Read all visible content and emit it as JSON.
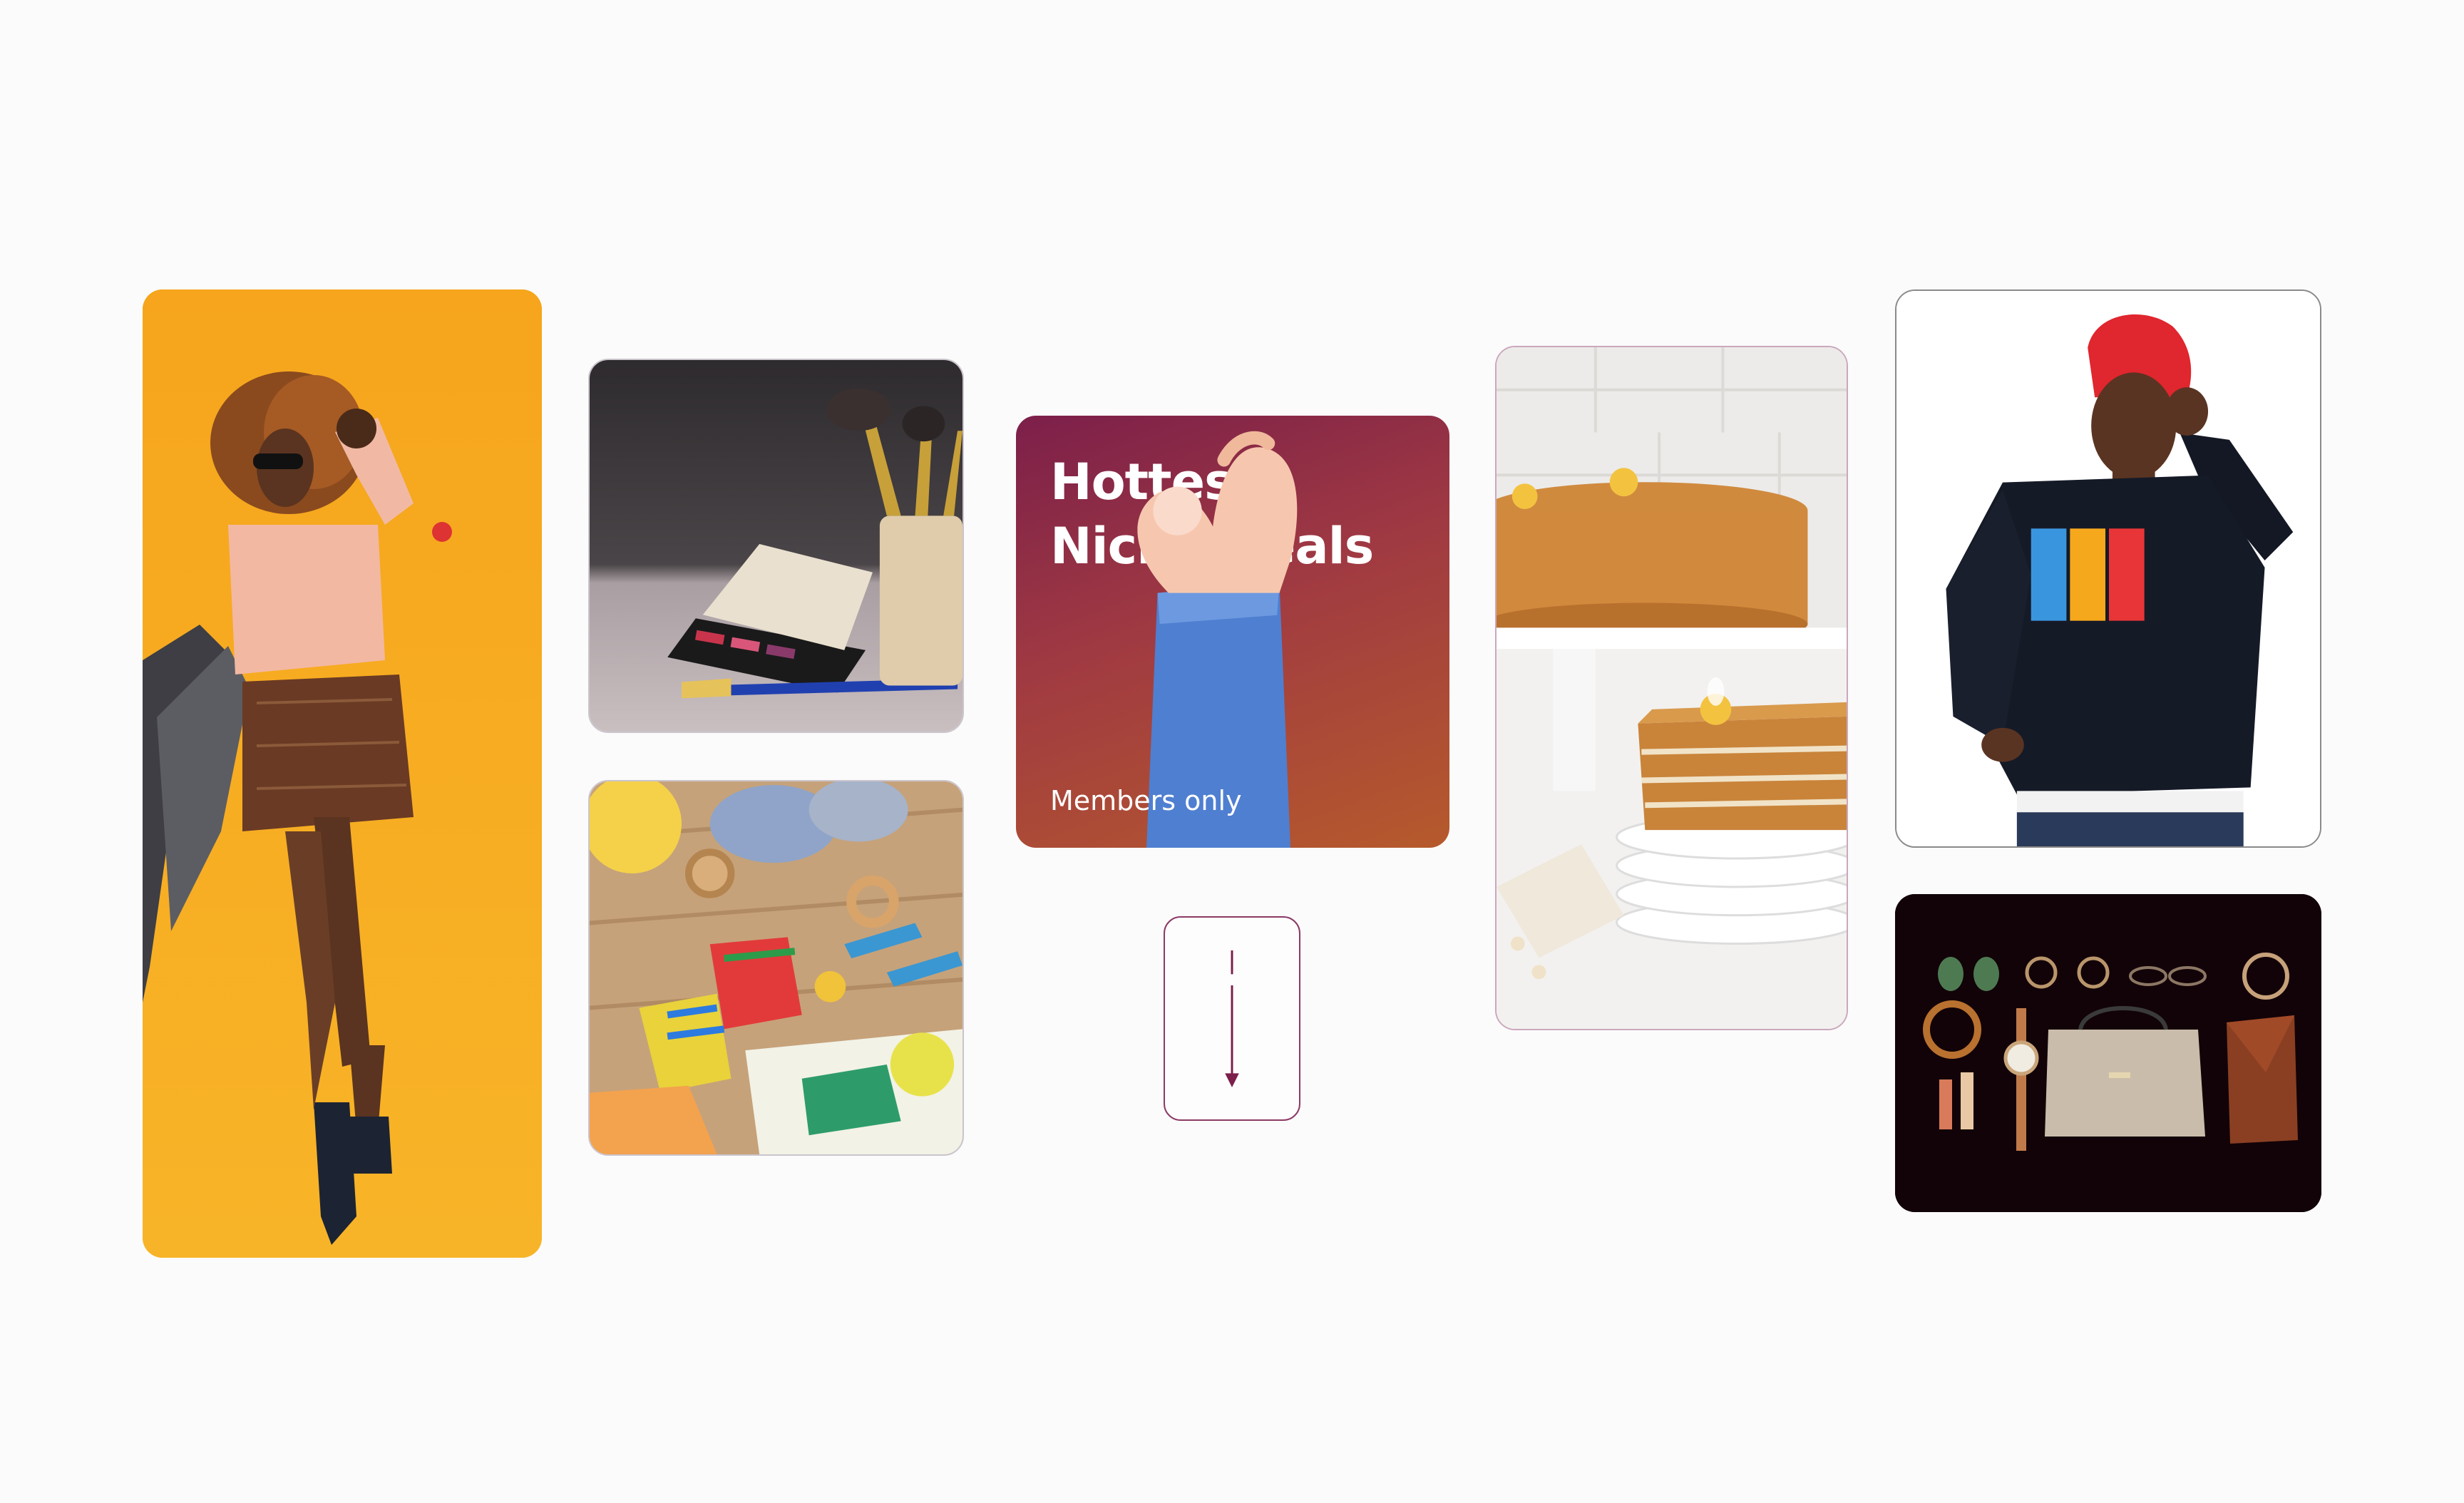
{
  "promo": {
    "title_line1": "Hottest",
    "title_line2": "Niche Deals",
    "subtitle": "Members only"
  },
  "tiles": [
    {
      "id": "fashion",
      "icon": "fashion-photo"
    },
    {
      "id": "makeup",
      "icon": "makeup-brushes-photo"
    },
    {
      "id": "baby",
      "icon": "baby-toys-photo"
    },
    {
      "id": "cake",
      "icon": "honey-cake-photo"
    },
    {
      "id": "sweatshirt",
      "icon": "sweatshirt-model-photo"
    },
    {
      "id": "accessories",
      "icon": "accessories-flatlay-photo"
    }
  ],
  "scroll_hint": {
    "icon": "arrow-down-icon"
  },
  "colors": {
    "background": "#fbfbfb",
    "accent": "#7c1f4a",
    "promo_gradient_end": "#b65a2c",
    "fashion_bg": "#f7aa1f",
    "accessories_bg": "#120308"
  }
}
